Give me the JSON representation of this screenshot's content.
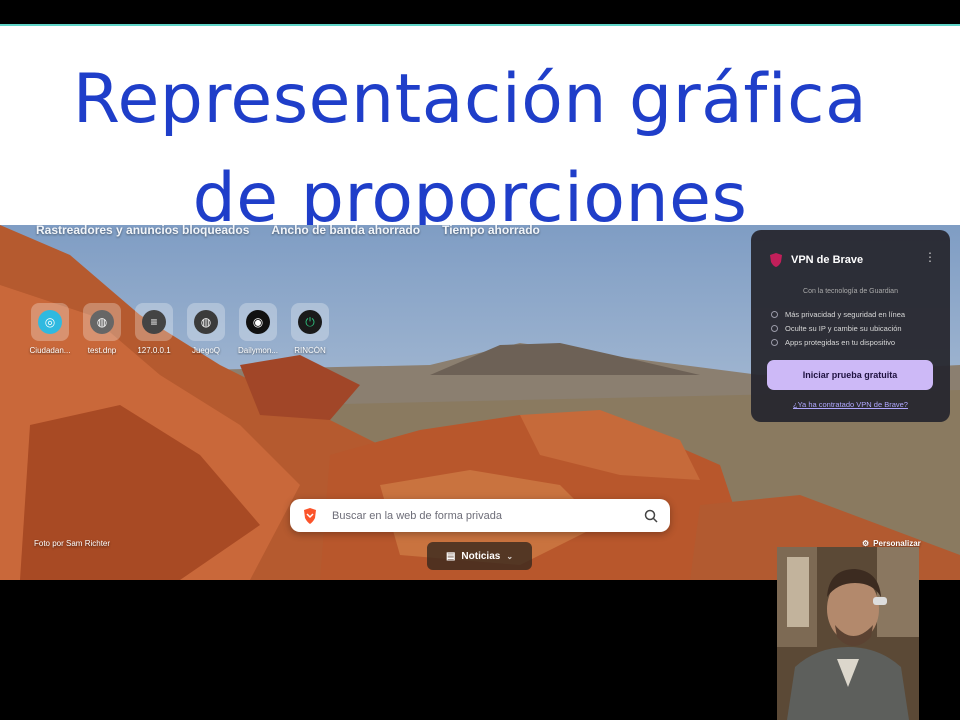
{
  "slide": {
    "title_line1": "Representación gráfica",
    "title_line2": "de proporciones"
  },
  "browser": {
    "stats": [
      "Rastreadores y anuncios bloqueados",
      "Ancho de banda ahorrado",
      "Tiempo ahorrado"
    ],
    "shortcuts": [
      {
        "label": "Ciudadan...",
        "icon": "ciudadano-icon"
      },
      {
        "label": "test.dnp",
        "icon": "globe-icon"
      },
      {
        "label": "127.0.0.1",
        "icon": "server-icon"
      },
      {
        "label": "JuegoQ",
        "icon": "globe-icon"
      },
      {
        "label": "Dailymon...",
        "icon": "dailymotion-icon"
      },
      {
        "label": "RINCÓN",
        "icon": "power-icon"
      }
    ],
    "vpn": {
      "title": "VPN de Brave",
      "powered_by": "Con la tecnología de Guardian",
      "features": [
        "Más privacidad y seguridad en línea",
        "Oculte su IP y cambie su ubicación",
        "Apps protegidas en tu dispositivo"
      ],
      "cta": "Iniciar prueba gratuita",
      "link": "¿Ya ha contratado VPN de Brave?"
    },
    "search_placeholder": "Buscar en la web de forma privada",
    "photo_credit": "Foto por Sam Richter",
    "customize": "Personalizar",
    "news_label": "Noticias"
  },
  "colors": {
    "title_blue": "#1f3ec9",
    "accent_line": "#5fd3c7",
    "brave_orange": "#fb542b",
    "vpn_button": "#cdb9f7"
  }
}
